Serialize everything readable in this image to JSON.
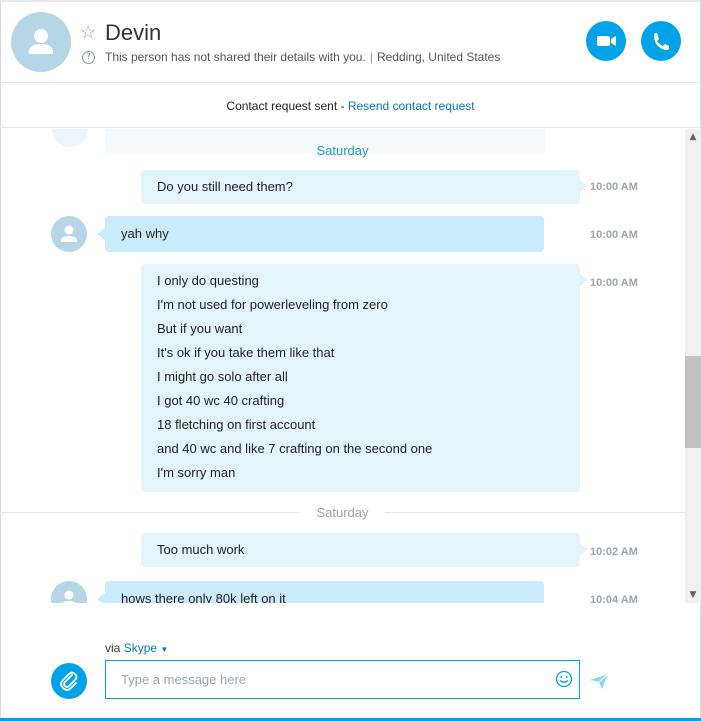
{
  "contact": {
    "name": "Devin",
    "status_text": "This person has not shared their details with you.",
    "location": "Redding, United States"
  },
  "notice": {
    "text": "Contact request sent - ",
    "link": "Resend contact request"
  },
  "days": [
    "Saturday",
    "Saturday"
  ],
  "messages": [
    {
      "dir": "out",
      "lines": [
        "Do you still need them?"
      ],
      "time": "10:00 AM"
    },
    {
      "dir": "in",
      "lines": [
        "yah why"
      ],
      "time": "10:00 AM"
    },
    {
      "dir": "out",
      "lines": [
        "I only do questing",
        "I'm not used for powerleveling from zero",
        "But if you want",
        "It's ok if you take them like that",
        "I might go solo after all",
        "I got 40 wc 40 crafting",
        "18 fletching on first account",
        "and 40 wc and like 7 crafting on the second one",
        "I'm sorry man"
      ],
      "time": "10:00 AM"
    },
    {
      "dir": "out",
      "lines": [
        "Too much work"
      ],
      "time": "10:02 AM"
    },
    {
      "dir": "in",
      "lines": [
        "hows there only 80k left on it"
      ],
      "time": "10:04 AM"
    }
  ],
  "compose": {
    "via_label": "via",
    "service": "Skype",
    "placeholder": "Type a message here"
  },
  "colors": {
    "accent": "#00a2e8",
    "link": "#0078c8",
    "bubble_out": "#e3f4fc",
    "bubble_in": "#c9ebfb"
  },
  "icons": [
    "star-icon",
    "info-icon",
    "video-call-icon",
    "phone-call-icon",
    "attach-icon",
    "emoji-icon",
    "send-icon",
    "scroll-up-icon",
    "scroll-down-icon"
  ]
}
